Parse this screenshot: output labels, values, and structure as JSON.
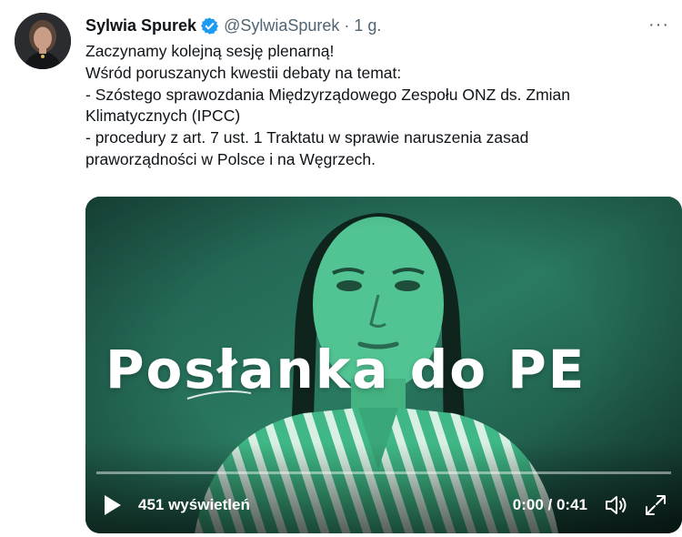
{
  "tweet": {
    "author_name": "Sylwia Spurek",
    "handle": "@SylwiaSpurek",
    "separator": "·",
    "time": "1 g.",
    "more": "···",
    "lines": [
      "Zaczynamy kolejną sesję plenarną!",
      "Wśród poruszanych kwestii debaty na temat:",
      "- Szóstego sprawozdania Międzyrządowego Zespołu ONZ ds. Zmian",
      "Klimatycznych (IPCC)",
      "- procedury z art. 7 ust. 1 Traktatu w sprawie naruszenia zasad",
      "praworządności w Polsce i na Węgrzech."
    ]
  },
  "media": {
    "overlay_title": "Posłanka do PE",
    "views": "451 wyświetleń",
    "timecode": "0:00 / 0:41",
    "progress": 0.0
  },
  "icons": {
    "verified": "verified-badge-icon",
    "play": "play-icon",
    "volume": "volume-icon",
    "fullscreen": "fullscreen-icon"
  },
  "colors": {
    "verified_blue": "#1d9bf0",
    "secondary_text": "#536471",
    "video_tint": "#2a8a6a"
  }
}
